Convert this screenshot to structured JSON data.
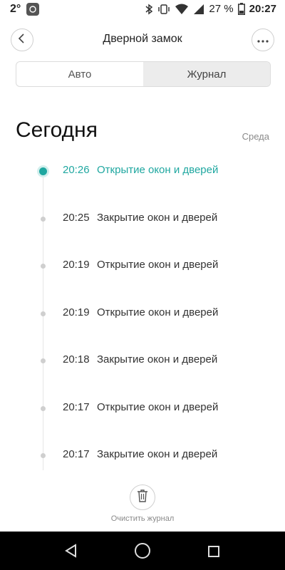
{
  "status_bar": {
    "temperature": "2°",
    "battery_percent": "27 %",
    "time": "20:27",
    "icons": [
      "app-icon",
      "bluetooth-icon",
      "vibrate-icon",
      "wifi-icon",
      "signal-icon",
      "battery-icon"
    ]
  },
  "header": {
    "title": "Дверной замок",
    "back_icon": "chevron-left-icon",
    "more_icon": "more-horizontal-icon"
  },
  "tabs": [
    {
      "label": "Авто",
      "active": false
    },
    {
      "label": "Журнал",
      "active": true
    }
  ],
  "day": {
    "title": "Сегодня",
    "weekday": "Среда"
  },
  "log": [
    {
      "time": "20:26",
      "event": "Открытие окон и дверей",
      "highlight": true
    },
    {
      "time": "20:25",
      "event": "Закрытие окон и дверей",
      "highlight": false
    },
    {
      "time": "20:19",
      "event": "Открытие окон и дверей",
      "highlight": false
    },
    {
      "time": "20:19",
      "event": "Открытие окон и дверей",
      "highlight": false
    },
    {
      "time": "20:18",
      "event": "Закрытие окон и дверей",
      "highlight": false
    },
    {
      "time": "20:17",
      "event": "Открытие окон и дверей",
      "highlight": false
    },
    {
      "time": "20:17",
      "event": "Закрытие окон и дверей",
      "highlight": false
    }
  ],
  "clear_button": {
    "label": "Очистить журнал",
    "icon": "trash-icon"
  },
  "colors": {
    "accent": "#1fa7a0",
    "text": "#333333",
    "muted": "#8a8a8a"
  }
}
